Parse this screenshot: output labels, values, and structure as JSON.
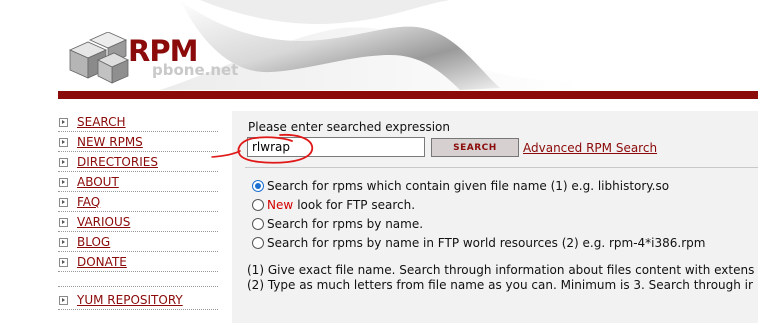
{
  "header": {
    "logo_text": "RPM",
    "logo_sub": "pbone.net"
  },
  "sidebar": {
    "items": [
      {
        "label": "SEARCH"
      },
      {
        "label": "NEW RPMS"
      },
      {
        "label": "DIRECTORIES"
      },
      {
        "label": "ABOUT"
      },
      {
        "label": "FAQ"
      },
      {
        "label": "VARIOUS"
      },
      {
        "label": "BLOG"
      },
      {
        "label": "DONATE"
      }
    ],
    "extra_item": {
      "label": "YUM REPOSITORY"
    }
  },
  "search": {
    "prompt": "Please enter searched expression",
    "value": "rlwrap",
    "button_label": "SEARCH",
    "advanced_link": "Advanced RPM Search"
  },
  "options": [
    {
      "text": "Search for rpms which contain given file name (1) e.g. libhistory.so",
      "checked": true
    },
    {
      "new": "New",
      "text": "look for FTP search.",
      "checked": false
    },
    {
      "text": "Search for rpms by name.",
      "checked": false
    },
    {
      "text": "Search for rpms by name in FTP world resources (2) e.g. rpm-4*i386.rpm",
      "checked": false
    }
  ],
  "notes": [
    "(1) Give exact file name. Search through information about files content with extens",
    "(2) Type as much letters from file name as you can. Minimum is 3. Search through ir"
  ],
  "colors": {
    "brand_red": "#8b0a0a",
    "panel_bg": "#f2f2f2",
    "radio_selected": "#1a6fd1",
    "annotation_red": "#e01818"
  }
}
